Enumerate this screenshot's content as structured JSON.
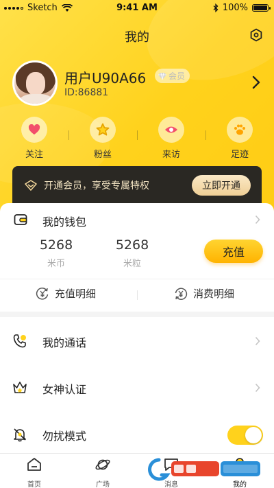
{
  "status_bar": {
    "carrier": "Sketch",
    "time": "9:41 AM",
    "battery": "100%"
  },
  "header": {
    "title": "我的"
  },
  "profile": {
    "username": "用户U90A66",
    "vip_label": "会员",
    "id_text": "ID:86881"
  },
  "stats": [
    {
      "label": "关注",
      "icon": "heart-icon"
    },
    {
      "label": "粉丝",
      "icon": "star-icon"
    },
    {
      "label": "来访",
      "icon": "eye-icon"
    },
    {
      "label": "足迹",
      "icon": "paw-icon"
    }
  ],
  "member_banner": {
    "text": "开通会员，享受专属特权",
    "button": "立即开通"
  },
  "wallet": {
    "title": "我的钱包",
    "balances": [
      {
        "value": "5268",
        "unit": "米币"
      },
      {
        "value": "5268",
        "unit": "米粒"
      }
    ],
    "recharge_button": "充值",
    "links": [
      {
        "label": "充值明细"
      },
      {
        "label": "消费明细"
      }
    ]
  },
  "menu": [
    {
      "label": "我的通话",
      "icon": "phone-icon"
    },
    {
      "label": "女神认证",
      "icon": "crown-icon"
    },
    {
      "label": "勿扰模式",
      "icon": "bell-off-icon",
      "toggle_on": true
    }
  ],
  "tabs": [
    {
      "label": "首页",
      "icon": "home-icon"
    },
    {
      "label": "广场",
      "icon": "planet-icon"
    },
    {
      "label": "消息",
      "icon": "message-icon"
    },
    {
      "label": "我的",
      "icon": "user-icon"
    }
  ],
  "colors": {
    "accent": "#ffd21c",
    "banner": "#2a2823",
    "gold_text": "#f2e3c2"
  }
}
